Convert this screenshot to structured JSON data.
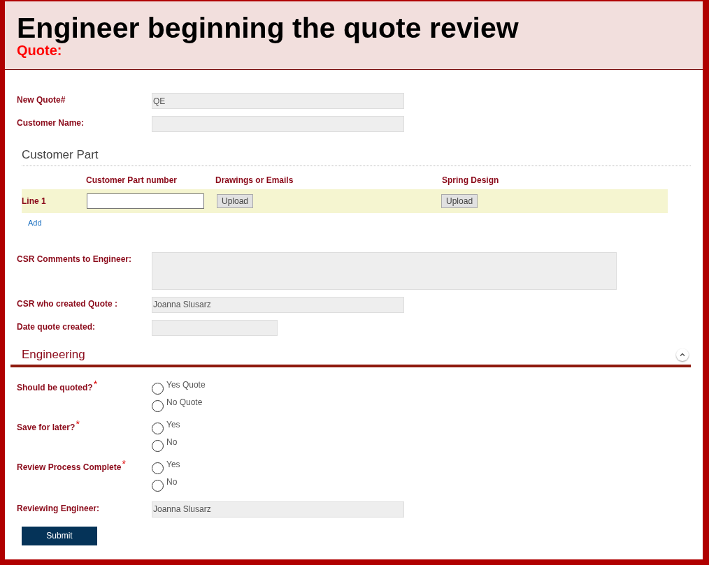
{
  "header": {
    "title": "Engineer beginning the quote review",
    "subtitle": "Quote:"
  },
  "top_fields": [
    {
      "label": "New Quote#",
      "value": "QE",
      "kind": "text"
    },
    {
      "label": "Customer Name:",
      "kind": "text"
    }
  ],
  "customer_part": {
    "heading": "Customer Part",
    "columns": [
      "Customer Part number",
      "Drawings or Emails",
      "Spring Design"
    ],
    "lines": [
      {
        "label": "Line 1",
        "uploads": [
          "Upload",
          "Upload"
        ]
      }
    ],
    "add_link": "Add"
  },
  "csr_fields": [
    {
      "label": "CSR Comments to Engineer:",
      "kind": "textarea"
    },
    {
      "label": "CSR who created Quote :",
      "value": "Joanna Slusarz",
      "kind": "text"
    },
    {
      "label": "Date quote created:",
      "kind": "date"
    }
  ],
  "engineering": {
    "heading": "Engineering",
    "questions": [
      {
        "label": "Should be quoted?",
        "required_mark": "*",
        "options": [
          {
            "label": "Yes Quote",
            "selected": false
          },
          {
            "label": "No Quote",
            "selected": false
          }
        ]
      },
      {
        "label": "Save for later?",
        "required_mark": "*",
        "options": [
          {
            "label": "Yes",
            "selected": false
          },
          {
            "label": "No",
            "selected": false
          }
        ]
      },
      {
        "label": "Review Process Complete",
        "required_mark": "*",
        "options": [
          {
            "label": "Yes",
            "selected": false
          },
          {
            "label": "No",
            "selected": false
          }
        ]
      }
    ],
    "reviewing_engineer": {
      "label": "Reviewing Engineer:",
      "value": "Joanna Slusarz",
      "kind": "text"
    }
  },
  "submit_button": "Submit"
}
